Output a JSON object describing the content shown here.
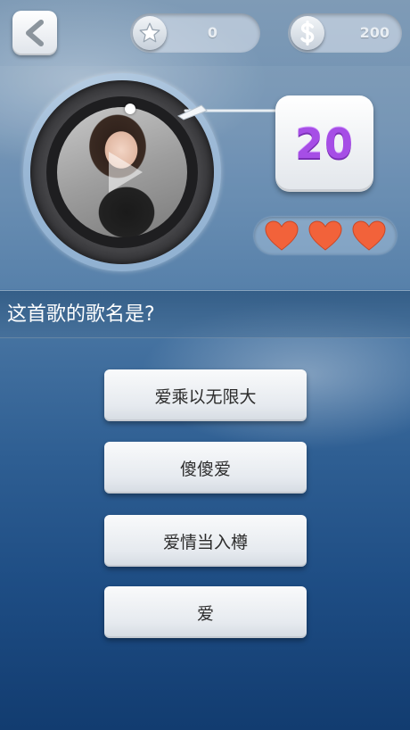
{
  "topbar": {
    "back_icon": "back-arrow-icon",
    "stars": {
      "icon": "star-icon",
      "value": "0"
    },
    "coins": {
      "icon": "dollar-icon",
      "value": "200"
    }
  },
  "player": {
    "record_icon": "vinyl-record",
    "timer": "20",
    "lives": 3,
    "heart_color": "#f2623a"
  },
  "question": {
    "text": "这首歌的歌名是?"
  },
  "options": [
    {
      "label": "爱乘以无限大"
    },
    {
      "label": "傻傻爱"
    },
    {
      "label": "爱情当入樽"
    },
    {
      "label": "爱"
    }
  ],
  "colors": {
    "timer_purple": "#a64ee6",
    "background_blue": "#2f5f93"
  }
}
